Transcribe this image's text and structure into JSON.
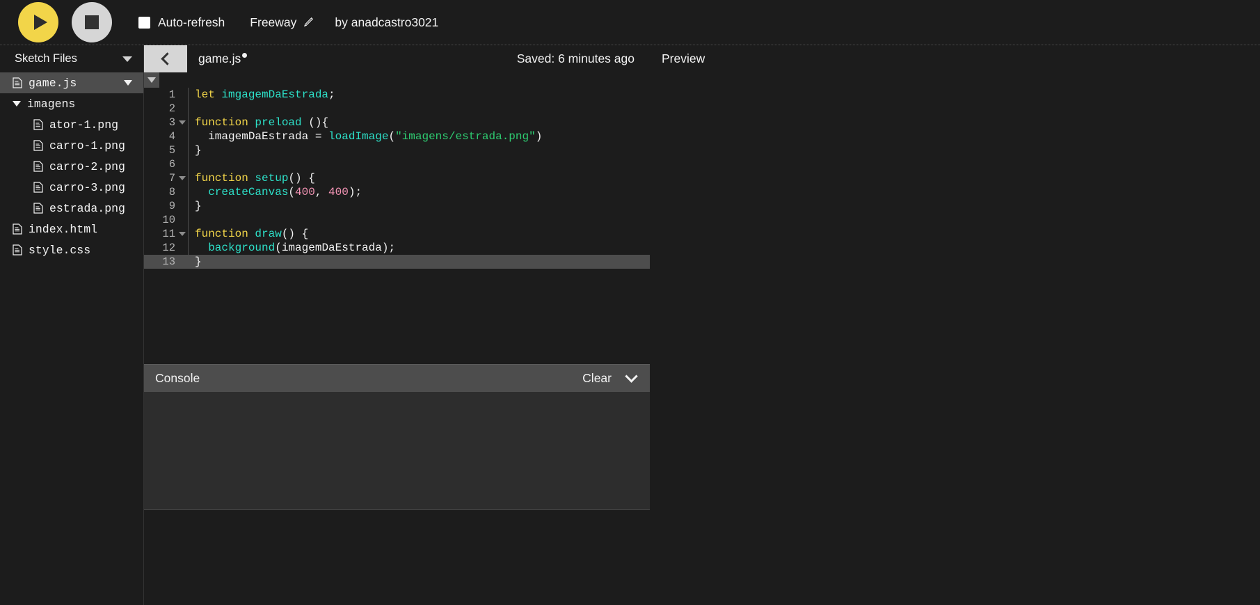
{
  "toolbar": {
    "play_label": "play-button",
    "stop_label": "stop-button",
    "autorefresh_label": "Auto-refresh",
    "autorefresh_checked": false,
    "sketch_name": "Freeway",
    "author": "by anadcastro3021",
    "accent_yellow": "#f2d549",
    "stop_grey": "#d6d6d6"
  },
  "sidebar": {
    "title": "Sketch Files",
    "items": [
      {
        "label": "game.js",
        "icon": "file-icon",
        "indent": 0,
        "selected": true,
        "caret": true,
        "type": "file"
      },
      {
        "label": "imagens",
        "icon": "folder-open-icon",
        "indent": 0,
        "selected": false,
        "caret": false,
        "type": "folder"
      },
      {
        "label": "ator-1.png",
        "icon": "file-icon",
        "indent": 2,
        "selected": false,
        "caret": false,
        "type": "file"
      },
      {
        "label": "carro-1.png",
        "icon": "file-icon",
        "indent": 2,
        "selected": false,
        "caret": false,
        "type": "file"
      },
      {
        "label": "carro-2.png",
        "icon": "file-icon",
        "indent": 2,
        "selected": false,
        "caret": false,
        "type": "file"
      },
      {
        "label": "carro-3.png",
        "icon": "file-icon",
        "indent": 2,
        "selected": false,
        "caret": false,
        "type": "file"
      },
      {
        "label": "estrada.png",
        "icon": "file-icon",
        "indent": 2,
        "selected": false,
        "caret": false,
        "type": "file"
      },
      {
        "label": "index.html",
        "icon": "file-icon",
        "indent": 0,
        "selected": false,
        "caret": false,
        "type": "file"
      },
      {
        "label": "style.css",
        "icon": "file-icon",
        "indent": 0,
        "selected": false,
        "caret": false,
        "type": "file"
      }
    ]
  },
  "editor": {
    "collapse_label": "collapse-sidebar",
    "file_tab_name": "game.js",
    "unsaved": true,
    "saved_status": "Saved: 6 minutes ago",
    "active_line": 13,
    "lines": [
      {
        "n": 1,
        "fold": false,
        "tokens": [
          {
            "t": "let ",
            "c": "kw"
          },
          {
            "t": "imgagemDaEstrada",
            "c": "fn"
          },
          {
            "t": ";",
            "c": "punc"
          }
        ]
      },
      {
        "n": 2,
        "fold": false,
        "tokens": []
      },
      {
        "n": 3,
        "fold": true,
        "tokens": [
          {
            "t": "function ",
            "c": "kw"
          },
          {
            "t": "preload",
            "c": "fn"
          },
          {
            "t": " (){",
            "c": "punc"
          }
        ]
      },
      {
        "n": 4,
        "fold": false,
        "tokens": [
          {
            "t": "  imagemDaEstrada = ",
            "c": "plain"
          },
          {
            "t": "loadImage",
            "c": "fn"
          },
          {
            "t": "(",
            "c": "punc"
          },
          {
            "t": "\"imagens/estrada.png\"",
            "c": "str"
          },
          {
            "t": ")",
            "c": "punc"
          }
        ]
      },
      {
        "n": 5,
        "fold": false,
        "tokens": [
          {
            "t": "}",
            "c": "punc"
          }
        ]
      },
      {
        "n": 6,
        "fold": false,
        "tokens": []
      },
      {
        "n": 7,
        "fold": true,
        "tokens": [
          {
            "t": "function ",
            "c": "kw"
          },
          {
            "t": "setup",
            "c": "fn"
          },
          {
            "t": "() {",
            "c": "punc"
          }
        ]
      },
      {
        "n": 8,
        "fold": false,
        "tokens": [
          {
            "t": "  ",
            "c": "plain"
          },
          {
            "t": "createCanvas",
            "c": "fn"
          },
          {
            "t": "(",
            "c": "punc"
          },
          {
            "t": "400",
            "c": "num"
          },
          {
            "t": ", ",
            "c": "punc"
          },
          {
            "t": "400",
            "c": "num"
          },
          {
            "t": ");",
            "c": "punc"
          }
        ]
      },
      {
        "n": 9,
        "fold": false,
        "tokens": [
          {
            "t": "}",
            "c": "punc"
          }
        ]
      },
      {
        "n": 10,
        "fold": false,
        "tokens": []
      },
      {
        "n": 11,
        "fold": true,
        "tokens": [
          {
            "t": "function ",
            "c": "kw"
          },
          {
            "t": "draw",
            "c": "fn"
          },
          {
            "t": "() {",
            "c": "punc"
          }
        ]
      },
      {
        "n": 12,
        "fold": false,
        "tokens": [
          {
            "t": "  ",
            "c": "plain"
          },
          {
            "t": "background",
            "c": "fn"
          },
          {
            "t": "(",
            "c": "punc"
          },
          {
            "t": "imagemDaEstrada",
            "c": "plain"
          },
          {
            "t": ");",
            "c": "punc"
          }
        ]
      },
      {
        "n": 13,
        "fold": false,
        "tokens": [
          {
            "t": "}",
            "c": "punc"
          }
        ]
      }
    ]
  },
  "console": {
    "title": "Console",
    "clear_label": "Clear",
    "collapse_icon": "chevron-down-icon",
    "messages": []
  },
  "preview": {
    "title": "Preview"
  }
}
